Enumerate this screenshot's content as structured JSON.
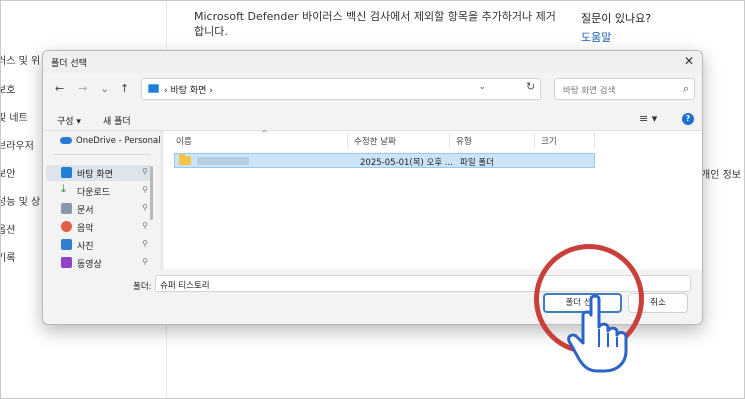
{
  "background_page": {
    "left_nav": [
      "러스 및 위",
      "보호",
      "및 네트",
      "브라우저",
      "보안",
      "성능 및 상",
      "옵션",
      "기록"
    ],
    "description": "Microsoft Defender 바이러스 백신 검사에서 제외할 항목을 추가하거나 제거합니다.",
    "question": "질문이 있나요?",
    "help_link": "도움말",
    "right_info": "개인 정보"
  },
  "dialog": {
    "title": "폴더 선택",
    "close_glyph": "✕",
    "nav": {
      "back": "←",
      "forward": "→",
      "down": "⌄",
      "up": "↑",
      "refresh": "↻"
    },
    "address": {
      "path": "›  바탕 화면  ›",
      "dropdown": "⌄"
    },
    "search": {
      "placeholder": "바탕 화면 검색",
      "icon": "⌕"
    },
    "toolbar": {
      "organize": "구성 ▾",
      "new_folder": "새 폴더",
      "view": "≡ ▾",
      "help": "?"
    },
    "sidebar": {
      "onedrive": "OneDrive - Personal",
      "items": [
        {
          "label": "바탕 화면",
          "icon": "desktop-icon",
          "color": "#1e7fd6"
        },
        {
          "label": "다운로드",
          "icon": "download-icon",
          "color": "#1f8a3d"
        },
        {
          "label": "문서",
          "icon": "document-icon",
          "color": "#7f8fa6"
        },
        {
          "label": "음악",
          "icon": "music-icon",
          "color": "#e35d4a"
        },
        {
          "label": "사진",
          "icon": "picture-icon",
          "color": "#2e7fd1"
        },
        {
          "label": "동영상",
          "icon": "video-icon",
          "color": "#8e44c5"
        }
      ],
      "pin_glyph": "📌"
    },
    "columns": [
      "이름",
      "수정한 날짜",
      "유형",
      "크기"
    ],
    "files": [
      {
        "name": "",
        "date": "2025-05-01(목) 오후 ...",
        "type": "파일 폴더",
        "size": ""
      }
    ],
    "folder_label": "폴더:",
    "folder_value": "슈퍼 티스토리",
    "select_button": "폴더 선택",
    "cancel_button": "취소"
  },
  "annotation": {
    "circle_color": "#c9403a"
  }
}
